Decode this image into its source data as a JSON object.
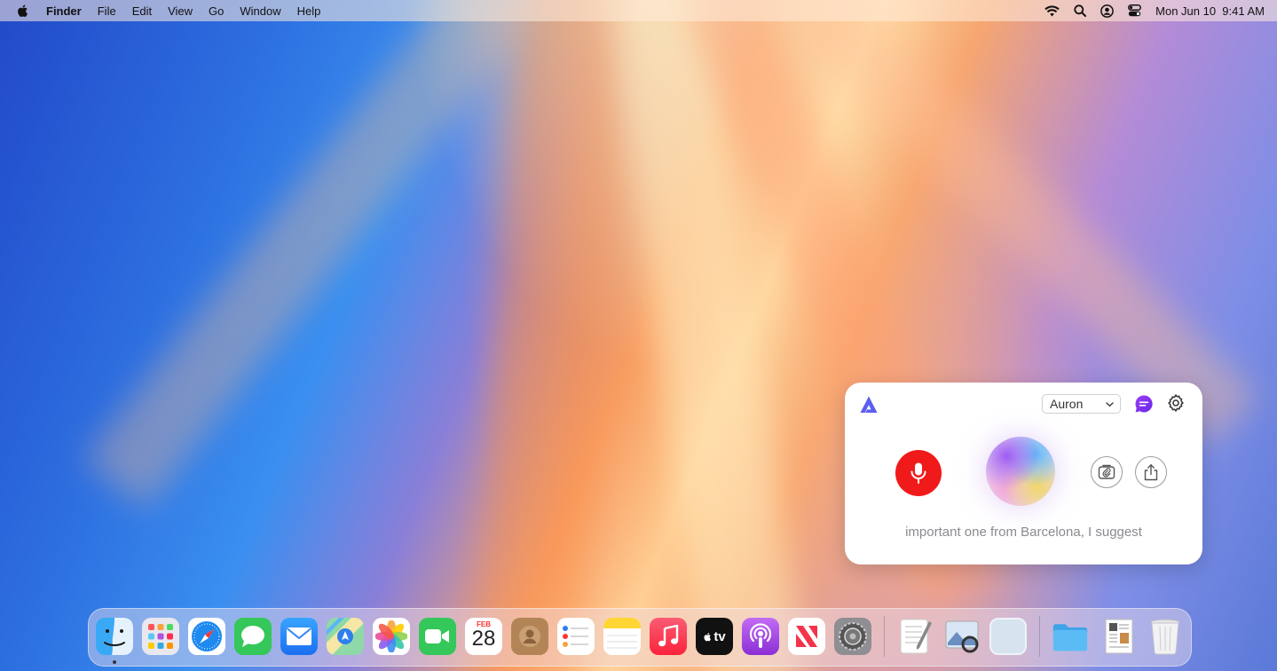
{
  "menubar": {
    "app_name": "Finder",
    "menus": [
      "File",
      "Edit",
      "View",
      "Go",
      "Window",
      "Help"
    ],
    "datetime": "Mon Jun 10  9:41 AM",
    "status_icons": [
      "wifi-icon",
      "search-icon",
      "user-icon",
      "control-center-icon"
    ]
  },
  "assistant": {
    "model": "Auron",
    "transcript": "important one from Barcelona, I suggest",
    "colors": {
      "mic": "#f11a1a",
      "accent": "#7b2ff2",
      "logo": "#5b5ff0"
    },
    "icons": [
      "logo-icon",
      "chat-icon",
      "gear-icon",
      "microphone-icon",
      "attach-icon",
      "share-icon"
    ]
  },
  "dock": {
    "calendar": {
      "month": "FEB",
      "day": "28"
    },
    "tv_label": "tv",
    "apps": [
      "Finder",
      "Launchpad",
      "Safari",
      "Messages",
      "Mail",
      "Maps",
      "Photos",
      "FaceTime",
      "Calendar",
      "Contacts",
      "Reminders",
      "Notes",
      "Music",
      "TV",
      "Podcasts",
      "News",
      "System Settings",
      "TextEdit",
      "Preview",
      "Window",
      "Folder",
      "Document",
      "Trash"
    ]
  }
}
